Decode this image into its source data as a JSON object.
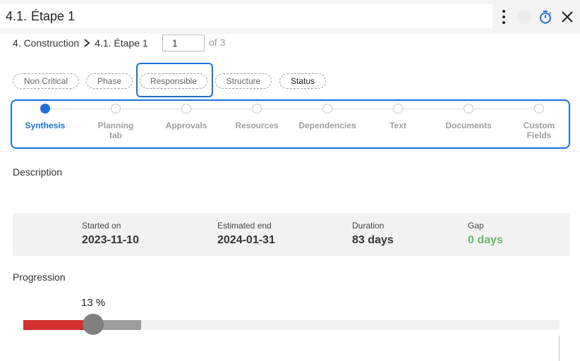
{
  "header": {
    "title_prefix": "4.1.",
    "title_value": "Étape 1"
  },
  "breadcrumb": {
    "items": [
      "4. Construction",
      "4.1. Étape 1"
    ]
  },
  "pager": {
    "current": "1",
    "of_label": "of 3"
  },
  "chips": [
    {
      "label": "Non Critical"
    },
    {
      "label": "Phase"
    },
    {
      "label": "Responsible"
    },
    {
      "label": "Structure"
    },
    {
      "label": "Status"
    }
  ],
  "steps": [
    {
      "label": "Synthesis",
      "active": true
    },
    {
      "label": "Planning tab"
    },
    {
      "label": "Approvals"
    },
    {
      "label": "Resources"
    },
    {
      "label": "Dependencies"
    },
    {
      "label": "Text"
    },
    {
      "label": "Documents"
    },
    {
      "label": "Custom Fields"
    }
  ],
  "description": {
    "label": "Description"
  },
  "stats": {
    "started_label": "Started on",
    "started_value": "2023-11-10",
    "end_label": "Estimated end",
    "end_value": "2024-01-31",
    "duration_label": "Duration",
    "duration_value": "83 days",
    "gap_label": "Gap",
    "gap_value": "0 days"
  },
  "progression": {
    "label": "Progression",
    "percent_text": "13 %",
    "value": 13
  },
  "colors": {
    "accent": "#1e6fd9",
    "progress_red": "#d32f2f",
    "gap_green": "#66bb6a"
  },
  "icons": {
    "menu": "kebab-icon",
    "timer": "stopwatch-icon",
    "close": "close-icon",
    "separator": "chevron-right-icon"
  }
}
